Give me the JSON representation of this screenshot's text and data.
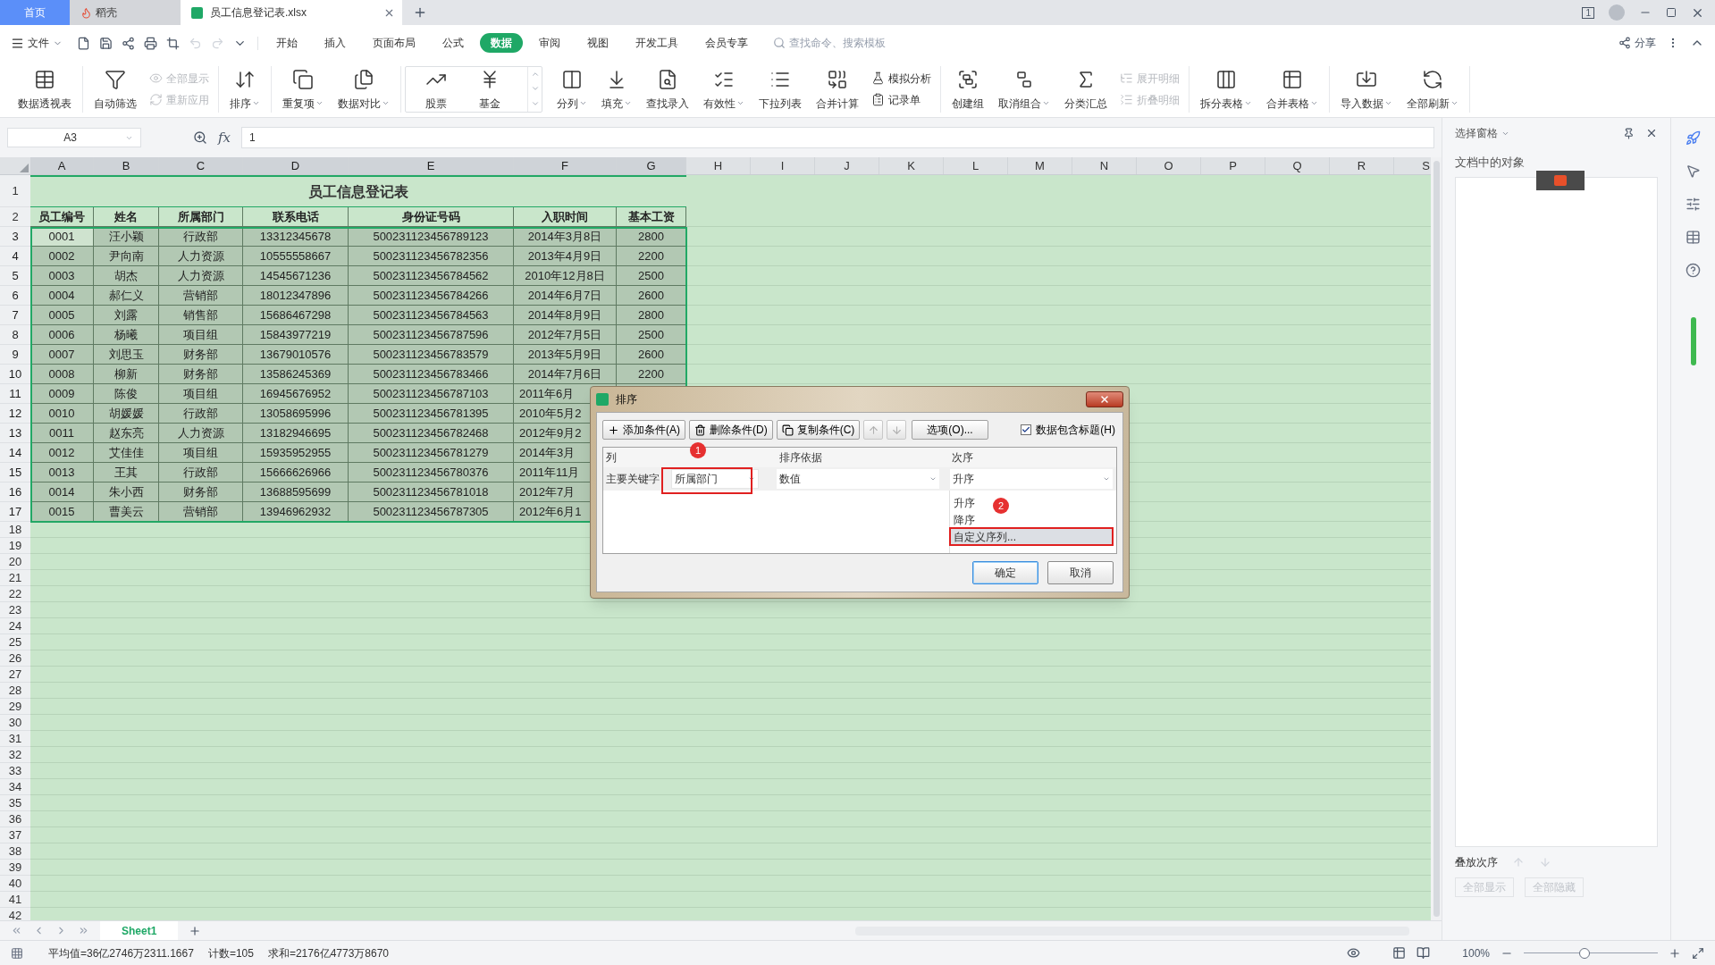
{
  "window": {
    "window_count": "1"
  },
  "tabs": [
    {
      "label": "首页",
      "kind": "home",
      "selected": false
    },
    {
      "label": "稻壳",
      "kind": "docer",
      "selected": false
    },
    {
      "label": "员工信息登记表.xlsx",
      "kind": "sheet",
      "selected": true
    }
  ],
  "menu": {
    "file": "文件",
    "tabs": [
      {
        "label": "开始",
        "selected": false
      },
      {
        "label": "插入",
        "selected": false
      },
      {
        "label": "页面布局",
        "selected": false
      },
      {
        "label": "公式",
        "selected": false
      },
      {
        "label": "数据",
        "selected": true
      },
      {
        "label": "审阅",
        "selected": false
      },
      {
        "label": "视图",
        "selected": false
      },
      {
        "label": "开发工具",
        "selected": false
      },
      {
        "label": "会员专享",
        "selected": false
      }
    ],
    "search": {
      "placeholder": "查找命令、搜索模板"
    },
    "share": "分享"
  },
  "ribbon": {
    "groups": [
      {
        "kind": "items",
        "items": [
          {
            "label": "数据透视表",
            "kind": "big",
            "dropdown": false,
            "disabled": false
          }
        ]
      },
      {
        "kind": "items",
        "items": [
          {
            "label": "自动筛选",
            "kind": "big",
            "dropdown": false,
            "disabled": false
          },
          {
            "label": "全部显示",
            "kind": "small",
            "dropdown": false,
            "disabled": true
          },
          {
            "label": "重新应用",
            "kind": "small",
            "dropdown": false,
            "disabled": true
          }
        ]
      },
      {
        "kind": "items",
        "items": [
          {
            "label": "排序",
            "kind": "big",
            "dropdown": true,
            "disabled": false
          }
        ]
      },
      {
        "kind": "items",
        "items": [
          {
            "label": "重复项",
            "kind": "big",
            "dropdown": true,
            "disabled": false
          },
          {
            "label": "数据对比",
            "kind": "big",
            "dropdown": true,
            "disabled": false
          }
        ]
      },
      {
        "kind": "gallery",
        "items": [
          {
            "label": "股票",
            "kind": "big",
            "dropdown": false,
            "disabled": false
          },
          {
            "label": "基金",
            "kind": "big",
            "dropdown": false,
            "disabled": false
          }
        ]
      },
      {
        "kind": "items",
        "items": [
          {
            "label": "分列",
            "kind": "big",
            "dropdown": true,
            "disabled": false
          },
          {
            "label": "填充",
            "kind": "big",
            "dropdown": true,
            "disabled": false
          },
          {
            "label": "查找录入",
            "kind": "big",
            "dropdown": false,
            "disabled": false
          },
          {
            "label": "有效性",
            "kind": "big",
            "dropdown": true,
            "disabled": false
          },
          {
            "label": "下拉列表",
            "kind": "big",
            "dropdown": false,
            "disabled": false
          },
          {
            "label": "合并计算",
            "kind": "big",
            "dropdown": false,
            "disabled": false
          },
          {
            "label": "模拟分析",
            "kind": "small",
            "dropdown": false,
            "disabled": false
          },
          {
            "label": "记录单",
            "kind": "small",
            "dropdown": false,
            "disabled": false
          }
        ]
      },
      {
        "kind": "items",
        "items": [
          {
            "label": "创建组",
            "kind": "big",
            "dropdown": false,
            "disabled": false
          },
          {
            "label": "取消组合",
            "kind": "big",
            "dropdown": true,
            "disabled": false
          },
          {
            "label": "分类汇总",
            "kind": "big",
            "dropdown": false,
            "disabled": false
          },
          {
            "label": "展开明细",
            "kind": "small",
            "dropdown": false,
            "disabled": true
          },
          {
            "label": "折叠明细",
            "kind": "small",
            "dropdown": false,
            "disabled": true
          }
        ]
      },
      {
        "kind": "items",
        "items": [
          {
            "label": "拆分表格",
            "kind": "big",
            "dropdown": true,
            "disabled": false
          },
          {
            "label": "合并表格",
            "kind": "big",
            "dropdown": true,
            "disabled": false
          }
        ]
      },
      {
        "kind": "items",
        "items": [
          {
            "label": "导入数据",
            "kind": "big",
            "dropdown": true,
            "disabled": false
          },
          {
            "label": "全部刷新",
            "kind": "big",
            "dropdown": true,
            "disabled": false
          }
        ]
      }
    ]
  },
  "formula_bar": {
    "name_box": "A3",
    "function_label": "fx",
    "value": "1"
  },
  "sheet": {
    "columns": [
      "A",
      "B",
      "C",
      "D",
      "E",
      "F",
      "G",
      "H",
      "I",
      "J",
      "K",
      "L",
      "M",
      "N",
      "O",
      "P",
      "Q",
      "R",
      "S"
    ],
    "rows": [
      {
        "number": "1",
        "kind": "title",
        "selected": false,
        "cells": [
          "员工信息登记表"
        ]
      },
      {
        "number": "2",
        "kind": "header",
        "selected": false,
        "cells": [
          "员工编号",
          "姓名",
          "所属部门",
          "联系电话",
          "身份证号码",
          "入职时间",
          "基本工资"
        ]
      },
      {
        "number": "3",
        "kind": "data",
        "selected": true,
        "active": true,
        "cells": [
          "0001",
          "汪小颖",
          "行政部",
          "13312345678",
          "500231123456789123",
          "2014年3月8日",
          "2800"
        ]
      },
      {
        "number": "4",
        "kind": "data",
        "selected": true,
        "active": false,
        "cells": [
          "0002",
          "尹向南",
          "人力资源",
          "10555558667",
          "500231123456782356",
          "2013年4月9日",
          "2200"
        ]
      },
      {
        "number": "5",
        "kind": "data",
        "selected": true,
        "active": false,
        "cells": [
          "0003",
          "胡杰",
          "人力资源",
          "14545671236",
          "500231123456784562",
          "2010年12月8日",
          "2500"
        ]
      },
      {
        "number": "6",
        "kind": "data",
        "selected": true,
        "active": false,
        "cells": [
          "0004",
          "郝仁义",
          "营销部",
          "18012347896",
          "500231123456784266",
          "2014年6月7日",
          "2600"
        ]
      },
      {
        "number": "7",
        "kind": "data",
        "selected": true,
        "active": false,
        "cells": [
          "0005",
          "刘露",
          "销售部",
          "15686467298",
          "500231123456784563",
          "2014年8月9日",
          "2800"
        ]
      },
      {
        "number": "8",
        "kind": "data",
        "selected": true,
        "active": false,
        "cells": [
          "0006",
          "杨曦",
          "项目组",
          "15843977219",
          "500231123456787596",
          "2012年7月5日",
          "2500"
        ]
      },
      {
        "number": "9",
        "kind": "data",
        "selected": true,
        "active": false,
        "cells": [
          "0007",
          "刘思玉",
          "财务部",
          "13679010576",
          "500231123456783579",
          "2013年5月9日",
          "2600"
        ]
      },
      {
        "number": "10",
        "kind": "data",
        "selected": true,
        "active": false,
        "cells": [
          "0008",
          "柳新",
          "财务部",
          "13586245369",
          "500231123456783466",
          "2014年7月6日",
          "2200"
        ]
      },
      {
        "number": "11",
        "kind": "data",
        "selected": true,
        "active": false,
        "cells": [
          "0009",
          "陈俊",
          "项目组",
          "16945676952",
          "500231123456787103",
          "2011年6月"
        ]
      },
      {
        "number": "12",
        "kind": "data",
        "selected": true,
        "active": false,
        "cells": [
          "0010",
          "胡媛媛",
          "行政部",
          "13058695996",
          "500231123456781395",
          "2010年5月2"
        ]
      },
      {
        "number": "13",
        "kind": "data",
        "selected": true,
        "active": false,
        "cells": [
          "0011",
          "赵东亮",
          "人力资源",
          "13182946695",
          "500231123456782468",
          "2012年9月2"
        ]
      },
      {
        "number": "14",
        "kind": "data",
        "selected": true,
        "active": false,
        "cells": [
          "0012",
          "艾佳佳",
          "项目组",
          "15935952955",
          "500231123456781279",
          "2014年3月"
        ]
      },
      {
        "number": "15",
        "kind": "data",
        "selected": true,
        "active": false,
        "cells": [
          "0013",
          "王其",
          "行政部",
          "15666626966",
          "500231123456780376",
          "2011年11月"
        ]
      },
      {
        "number": "16",
        "kind": "data",
        "selected": true,
        "active": false,
        "cells": [
          "0014",
          "朱小西",
          "财务部",
          "13688595699",
          "500231123456781018",
          "2012年7月"
        ]
      },
      {
        "number": "17",
        "kind": "data",
        "selected": true,
        "active": false,
        "cells": [
          "0015",
          "曹美云",
          "营销部",
          "13946962932",
          "500231123456787305",
          "2012年6月1"
        ]
      },
      {
        "number": "18",
        "kind": "empty",
        "selected": false
      },
      {
        "number": "19",
        "kind": "empty",
        "selected": false
      },
      {
        "number": "20",
        "kind": "empty",
        "selected": false
      },
      {
        "number": "21",
        "kind": "empty",
        "selected": false
      },
      {
        "number": "22",
        "kind": "empty",
        "selected": false
      },
      {
        "number": "23",
        "kind": "empty",
        "selected": false
      },
      {
        "number": "24",
        "kind": "empty",
        "selected": false
      },
      {
        "number": "25",
        "kind": "empty",
        "selected": false
      },
      {
        "number": "26",
        "kind": "empty",
        "selected": false
      },
      {
        "number": "27",
        "kind": "empty",
        "selected": false
      },
      {
        "number": "28",
        "kind": "empty",
        "selected": false
      },
      {
        "number": "29",
        "kind": "empty",
        "selected": false
      },
      {
        "number": "30",
        "kind": "empty",
        "selected": false
      },
      {
        "number": "31",
        "kind": "empty",
        "selected": false
      },
      {
        "number": "32",
        "kind": "empty",
        "selected": false
      },
      {
        "number": "33",
        "kind": "empty",
        "selected": false
      },
      {
        "number": "34",
        "kind": "empty",
        "selected": false
      },
      {
        "number": "35",
        "kind": "empty",
        "selected": false
      },
      {
        "number": "36",
        "kind": "empty",
        "selected": false
      },
      {
        "number": "37",
        "kind": "empty",
        "selected": false
      },
      {
        "number": "38",
        "kind": "empty",
        "selected": false
      },
      {
        "number": "39",
        "kind": "empty",
        "selected": false
      },
      {
        "number": "40",
        "kind": "empty",
        "selected": false
      },
      {
        "number": "41",
        "kind": "empty",
        "selected": false
      },
      {
        "number": "42",
        "kind": "empty",
        "selected": false
      }
    ]
  },
  "dialog": {
    "title": "排序",
    "buttons": [
      {
        "label": "添加条件(A)",
        "kind": "add",
        "disabled": false
      },
      {
        "label": "删除条件(D)",
        "kind": "delete",
        "disabled": false
      },
      {
        "label": "复制条件(C)",
        "kind": "copy",
        "disabled": false
      },
      {
        "kind": "up",
        "disabled": true
      },
      {
        "kind": "down",
        "disabled": true
      },
      {
        "label": "选项(O)...",
        "kind": "options",
        "disabled": false
      }
    ],
    "header_checkbox": {
      "label": "数据包含标题(H)",
      "checked": true
    },
    "columns": [
      "列",
      "排序依据",
      "次序"
    ],
    "rows": [
      {
        "label": "主要关键字",
        "column": "所属部门",
        "basis": "数值",
        "order": "升序"
      }
    ],
    "order_options": [
      {
        "label": "升序",
        "selected": false
      },
      {
        "label": "降序",
        "selected": false
      },
      {
        "label": "自定义序列...",
        "selected": true
      }
    ],
    "annotations": [
      {
        "label": "1"
      },
      {
        "label": "2"
      }
    ],
    "actions": [
      {
        "label": "确定",
        "primary": true
      },
      {
        "label": "取消",
        "primary": false
      }
    ]
  },
  "selection_pane": {
    "title": "选择窗格",
    "objects_label": "文档中的对象",
    "order_label": "叠放次序",
    "buttons": [
      {
        "label": "全部显示",
        "disabled": true
      },
      {
        "label": "全部隐藏",
        "disabled": true
      }
    ]
  },
  "sheet_tabs": [
    {
      "label": "Sheet1",
      "selected": true
    }
  ],
  "status_bar": {
    "stats": [
      "平均值=36亿2746万2311.1667",
      "计数=105",
      "求和=2176亿4773万8670"
    ],
    "zoom": "100%",
    "zoom_slider": {
      "level": 0.45
    }
  }
}
